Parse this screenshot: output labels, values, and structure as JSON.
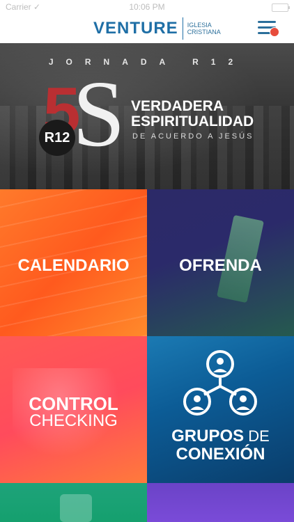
{
  "status": {
    "carrier": "Carrier ✓",
    "time": "10:06 PM"
  },
  "header": {
    "logo_main": "VENTURE",
    "logo_sub_line1": "IGLESIA",
    "logo_sub_line2": "CRISTIANA",
    "menu_icon": "hamburger-icon",
    "notification_color": "#e74c3c",
    "accent": "#1f6fa6"
  },
  "banner": {
    "kicker": "JORNADA R12",
    "big_number": "5",
    "big_letter": "S",
    "badge": "R12",
    "title_line1": "VERDADERA",
    "title_line2": "ESPIRITUALIDAD",
    "subtitle": "DE ACUERDO A JESÚS"
  },
  "tiles": [
    {
      "id": "calendario",
      "label": "CALENDARIO"
    },
    {
      "id": "ofrenda",
      "label": "OFRENDA"
    },
    {
      "id": "control",
      "label_line1": "CONTROL",
      "label_line2": "CHECKING"
    },
    {
      "id": "grupos",
      "label_line1_a": "GRUPOS",
      "label_line1_b": " DE",
      "label_line2": "CONEXIÓN"
    }
  ]
}
